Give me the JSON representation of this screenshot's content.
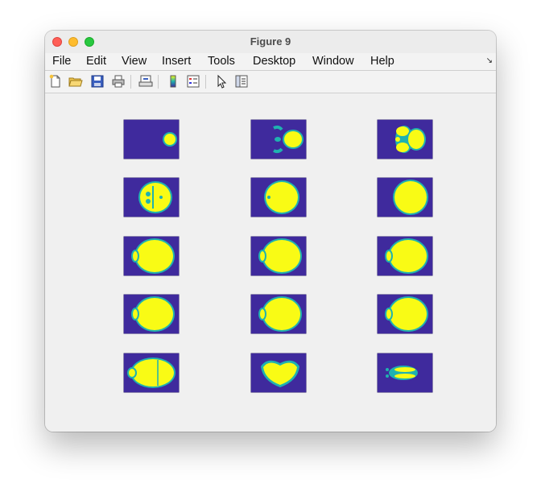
{
  "window": {
    "title": "Figure 9"
  },
  "menu": {
    "items": [
      {
        "id": "file",
        "label": "File"
      },
      {
        "id": "edit",
        "label": "Edit"
      },
      {
        "id": "view",
        "label": "View"
      },
      {
        "id": "insert",
        "label": "Insert"
      },
      {
        "id": "tools",
        "label": "Tools"
      },
      {
        "id": "desktop",
        "label": "Desktop"
      },
      {
        "id": "window",
        "label": "Window"
      },
      {
        "id": "help",
        "label": "Help"
      }
    ],
    "dock_icon": "dock-arrow-icon"
  },
  "toolbar": {
    "buttons": [
      {
        "id": "new",
        "icon": "new-figure-icon"
      },
      {
        "id": "open",
        "icon": "open-file-icon"
      },
      {
        "id": "save",
        "icon": "save-icon"
      },
      {
        "id": "print",
        "icon": "print-icon"
      },
      {
        "id": "link",
        "icon": "link-plot-icon"
      },
      {
        "id": "colorbar",
        "icon": "colorbar-icon"
      },
      {
        "id": "legend",
        "icon": "legend-icon"
      },
      {
        "id": "pointer",
        "icon": "pointer-icon"
      },
      {
        "id": "property",
        "icon": "property-inspector-icon"
      }
    ]
  },
  "colors": {
    "background": "#3f2a9d",
    "edge": "#1fb2b0",
    "fill": "#f9fb15"
  },
  "figure": {
    "rows": 5,
    "cols": 3,
    "slices": [
      {
        "shape": "small-right-blob"
      },
      {
        "shape": "eyes-and-blob"
      },
      {
        "shape": "multi-lobe"
      },
      {
        "shape": "lobed-skull"
      },
      {
        "shape": "round-skull"
      },
      {
        "shape": "round-skull-right"
      },
      {
        "shape": "skull-large"
      },
      {
        "shape": "skull-large"
      },
      {
        "shape": "skull-large"
      },
      {
        "shape": "skull-large"
      },
      {
        "shape": "skull-large"
      },
      {
        "shape": "skull-large"
      },
      {
        "shape": "skull-notched"
      },
      {
        "shape": "heart-shape"
      },
      {
        "shape": "thin-lobes"
      }
    ]
  }
}
